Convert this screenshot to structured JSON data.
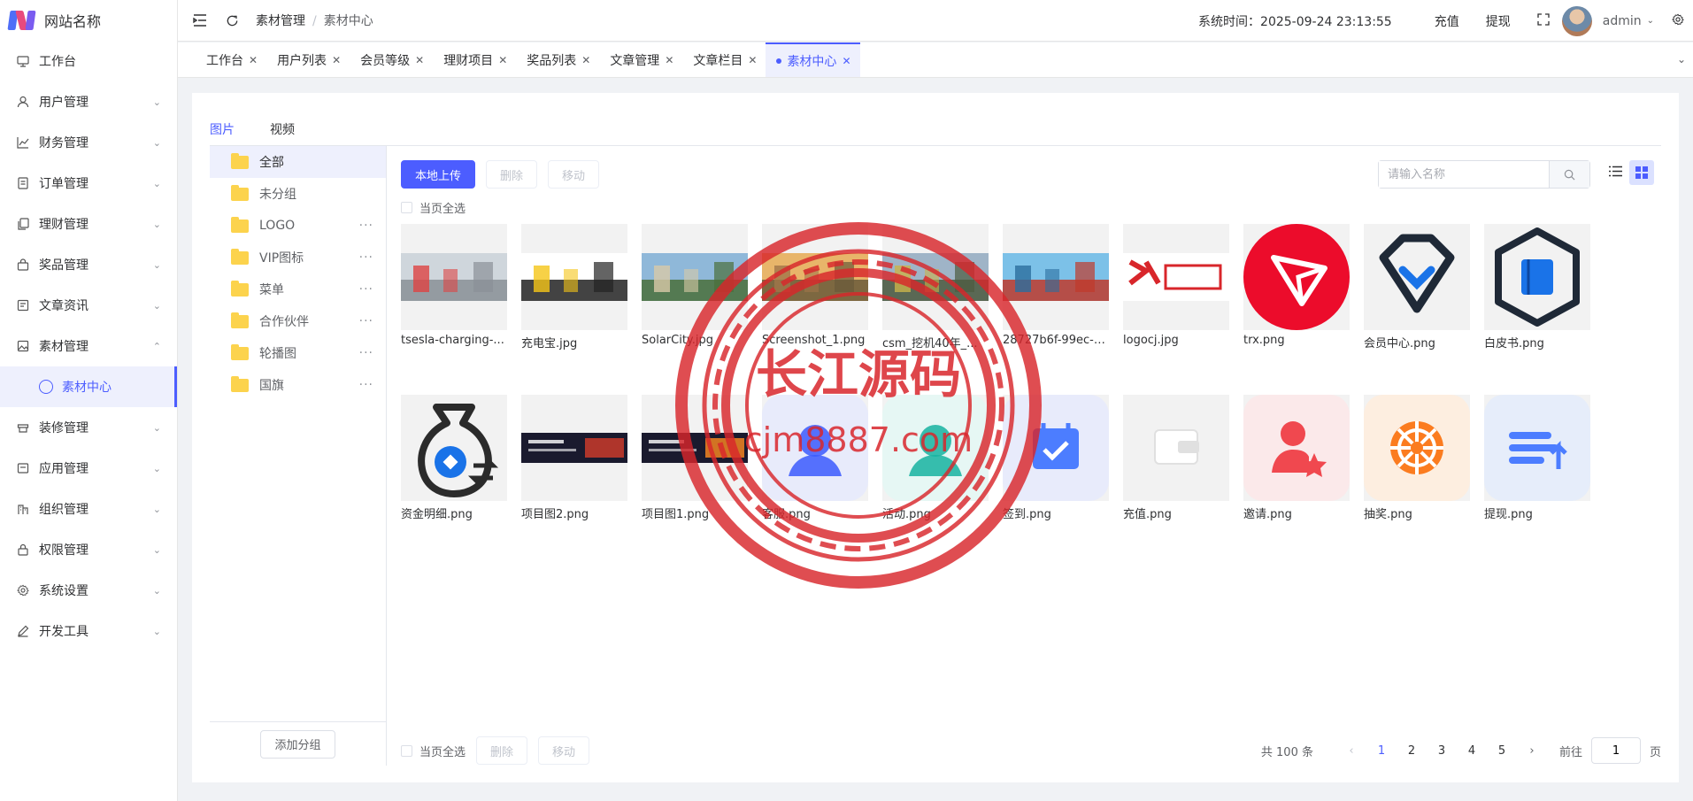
{
  "app": {
    "name": "网站名称"
  },
  "sidebar": {
    "items": [
      {
        "label": "工作台",
        "icon": "monitor-icon",
        "has_children": false
      },
      {
        "label": "用户管理",
        "icon": "user-icon",
        "has_children": true
      },
      {
        "label": "财务管理",
        "icon": "chart-icon",
        "has_children": true
      },
      {
        "label": "订单管理",
        "icon": "order-icon",
        "has_children": true
      },
      {
        "label": "理财管理",
        "icon": "copy-icon",
        "has_children": true
      },
      {
        "label": "奖品管理",
        "icon": "bag-icon",
        "has_children": true
      },
      {
        "label": "文章资讯",
        "icon": "article-icon",
        "has_children": true
      },
      {
        "label": "素材管理",
        "icon": "image-icon",
        "has_children": true,
        "expanded": true
      },
      {
        "label": "装修管理",
        "icon": "decor-icon",
        "has_children": true
      },
      {
        "label": "应用管理",
        "icon": "app-icon",
        "has_children": true
      },
      {
        "label": "组织管理",
        "icon": "org-icon",
        "has_children": true
      },
      {
        "label": "权限管理",
        "icon": "lock-icon",
        "has_children": true
      },
      {
        "label": "系统设置",
        "icon": "gear-icon",
        "has_children": true
      },
      {
        "label": "开发工具",
        "icon": "pen-icon",
        "has_children": true
      }
    ],
    "active_sub": {
      "label": "素材中心"
    }
  },
  "header": {
    "breadcrumb": [
      "素材管理",
      "素材中心"
    ],
    "system_time": "系统时间：2025-09-24 23:13:55",
    "recharge": "充值",
    "withdraw": "提现",
    "user": "admin"
  },
  "tabs": [
    "工作台",
    "用户列表",
    "会员等级",
    "理财项目",
    "奖品列表",
    "文章管理",
    "文章栏目",
    "素材中心"
  ],
  "active_tab": "素材中心",
  "media_tabs": [
    "图片",
    "视频"
  ],
  "groups": [
    {
      "label": "全部",
      "active": true,
      "more": false
    },
    {
      "label": "未分组",
      "more": false
    },
    {
      "label": "LOGO",
      "more": true
    },
    {
      "label": "VIP图标",
      "more": true
    },
    {
      "label": "菜单",
      "more": true
    },
    {
      "label": "合作伙伴",
      "more": true
    },
    {
      "label": "轮播图",
      "more": true
    },
    {
      "label": "国旗",
      "more": true
    }
  ],
  "add_group": "添加分组",
  "toolbar": {
    "upload": "本地上传",
    "delete": "删除",
    "move": "移动"
  },
  "search": {
    "placeholder": "请输入名称",
    "value": ""
  },
  "select_page": "当页全选",
  "files": [
    {
      "name": "tsesla-charging-...",
      "kind": "photo",
      "colors": [
        "#cfd6dc",
        "#8a9097",
        "#d44"
      ]
    },
    {
      "name": "充电宝.jpg",
      "kind": "photo",
      "colors": [
        "#fff",
        "#222",
        "#f5c518"
      ]
    },
    {
      "name": "SolarCity.jpg",
      "kind": "photo",
      "colors": [
        "#8fb8d9",
        "#4a6f3a",
        "#d8c9a7"
      ]
    },
    {
      "name": "Screenshot_1.png",
      "kind": "photo",
      "colors": [
        "#e8b56a",
        "#6a5a3a",
        "#a0764a"
      ]
    },
    {
      "name": "csm_挖机40年_...",
      "kind": "photo",
      "colors": [
        "#9fb4c7",
        "#4d5b40",
        "#c9b34a"
      ]
    },
    {
      "name": "28727b6f-99ec-4...",
      "kind": "photo",
      "colors": [
        "#7cc1e8",
        "#c0392b",
        "#2c6e9e"
      ]
    },
    {
      "name": "logocj.jpg",
      "kind": "logo",
      "colors": [
        "#fff",
        "#d8262b",
        "#d8262b"
      ]
    },
    {
      "name": "trx.png",
      "kind": "trx",
      "colors": [
        "#ec0c2b",
        "#fff",
        "#fff"
      ]
    },
    {
      "name": "会员中心.png",
      "kind": "diamond",
      "colors": [
        "#f2f2f2",
        "#1f2937",
        "#1a73e8"
      ]
    },
    {
      "name": "白皮书.png",
      "kind": "hexbook",
      "colors": [
        "#f2f2f2",
        "#1f2937",
        "#1a73e8"
      ]
    },
    {
      "name": "资金明细.png",
      "kind": "moneybag",
      "colors": [
        "#f2f2f2",
        "#2b2b2b",
        "#1a73e8"
      ]
    },
    {
      "name": "项目图2.png",
      "kind": "banner",
      "colors": [
        "#1a1a2e",
        "#c0392b",
        "#fff"
      ]
    },
    {
      "name": "项目图1.png",
      "kind": "banner",
      "colors": [
        "#1a1a2e",
        "#e67e22",
        "#fff"
      ]
    },
    {
      "name": "客服.png",
      "kind": "iconsq",
      "colors": [
        "#e8ebfb",
        "#3b5bfd",
        "#3b5bfd"
      ]
    },
    {
      "name": "活动.png",
      "kind": "iconsq",
      "colors": [
        "#e6f7f4",
        "#16b3a0",
        "#16b3a0"
      ]
    },
    {
      "name": "签到.png",
      "kind": "calendar",
      "colors": [
        "#e8ebfb",
        "#4c7dff",
        "#fff"
      ]
    },
    {
      "name": "充值.png",
      "kind": "wallet",
      "colors": [
        "#f2f2f2",
        "#fff",
        "#e0e0e0"
      ]
    },
    {
      "name": "邀请.png",
      "kind": "invite",
      "colors": [
        "#fbe9ea",
        "#f0484f",
        "#f0484f"
      ]
    },
    {
      "name": "抽奖.png",
      "kind": "wheel",
      "colors": [
        "#fdeee0",
        "#fb7c20",
        "#fff"
      ]
    },
    {
      "name": "提现.png",
      "kind": "withdraw",
      "colors": [
        "#e6edfa",
        "#4c7dff",
        "#4c7dff"
      ]
    }
  ],
  "pagination": {
    "total": "共 100 条",
    "pages": [
      "1",
      "2",
      "3",
      "4",
      "5"
    ],
    "current": "1",
    "goto_label": "前往",
    "goto_value": "1",
    "page_suffix": "页"
  },
  "watermark": {
    "title": "长江源码",
    "url": "cjm8887.com",
    "color": "#d8262b"
  }
}
